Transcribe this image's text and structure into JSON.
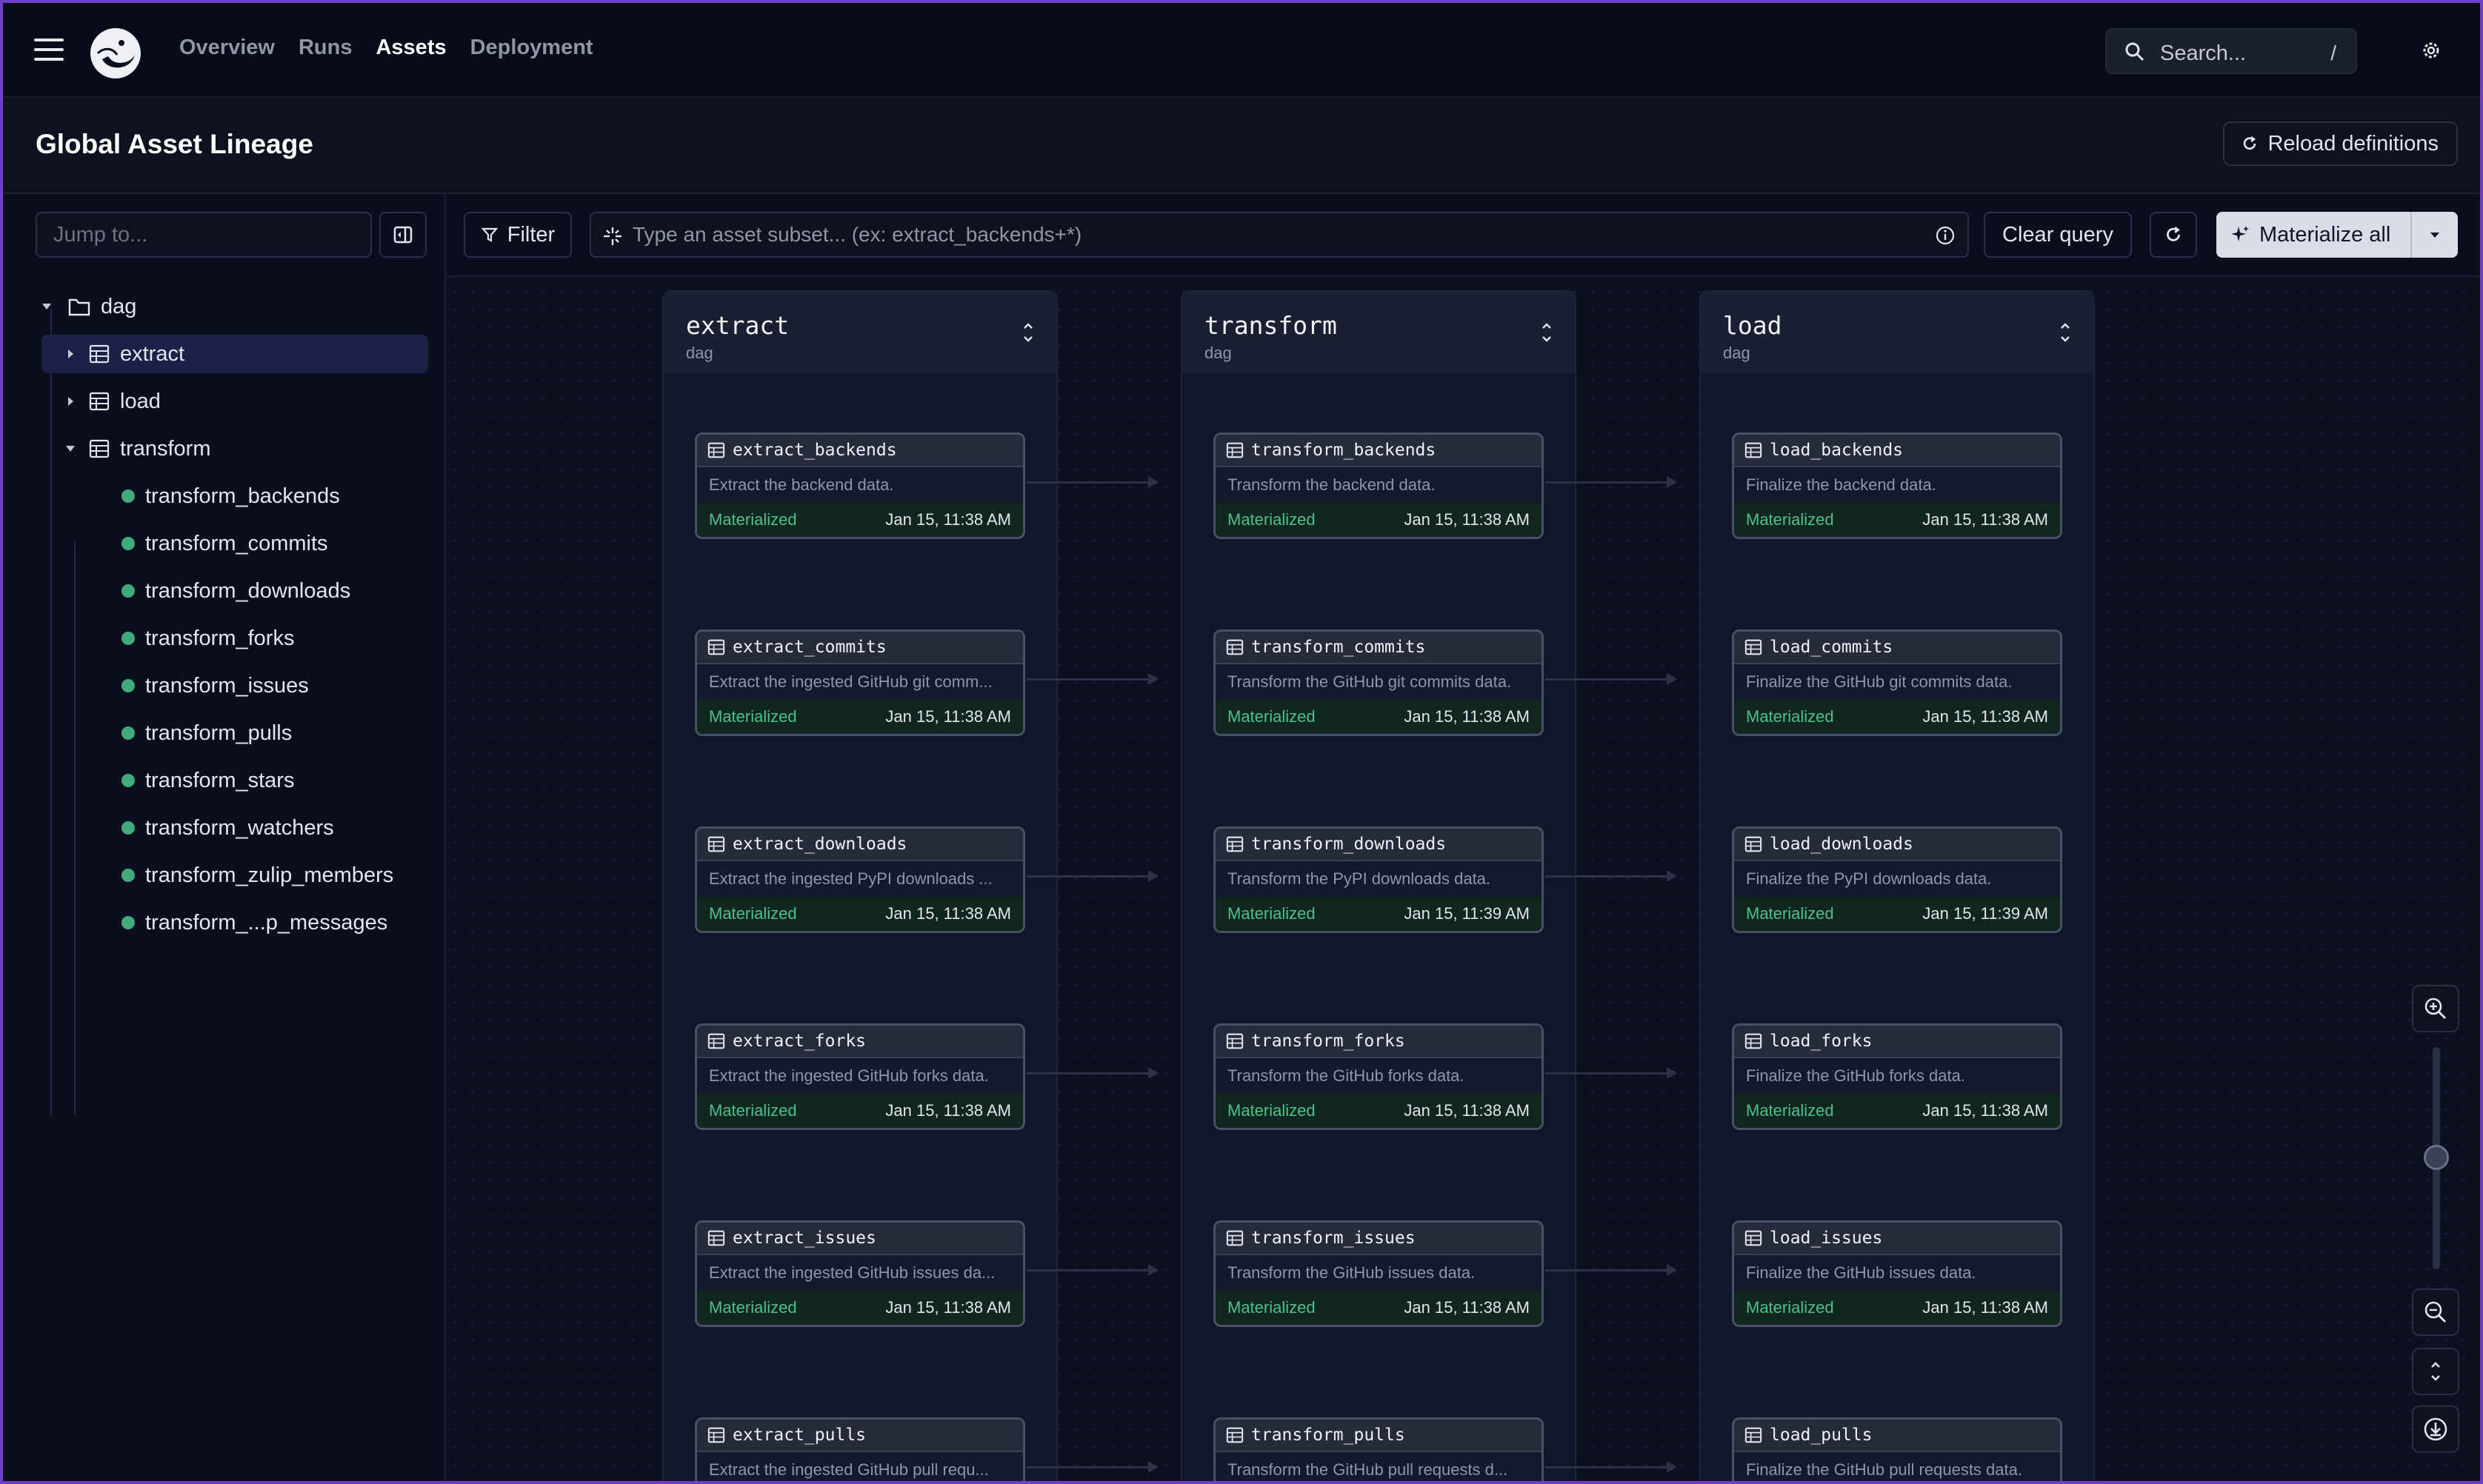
{
  "app": {
    "nav": [
      "Overview",
      "Runs",
      "Assets",
      "Deployment"
    ],
    "active_nav": "Assets",
    "search_placeholder": "Search...",
    "search_shortcut": "/"
  },
  "header": {
    "title": "Global Asset Lineage",
    "reload_label": "Reload definitions"
  },
  "sidebar": {
    "jump_placeholder": "Jump to...",
    "tree": {
      "root": "dag",
      "folders": [
        "extract",
        "load",
        "transform"
      ],
      "selected": "extract",
      "transform_children": [
        "transform_backends",
        "transform_commits",
        "transform_downloads",
        "transform_forks",
        "transform_issues",
        "transform_pulls",
        "transform_stars",
        "transform_watchers",
        "transform_zulip_members",
        "transform_...p_messages"
      ]
    }
  },
  "toolbar": {
    "filter_label": "Filter",
    "query_placeholder": "Type an asset subset... (ex: extract_backends+*)",
    "clear_label": "Clear query",
    "materialize_label": "Materialize all"
  },
  "groups": [
    {
      "title": "extract",
      "subtitle": "dag",
      "nodes": [
        {
          "name": "extract_backends",
          "desc": "Extract the backend data.",
          "status": "Materialized",
          "time": "Jan 15, 11:38 AM"
        },
        {
          "name": "extract_commits",
          "desc": "Extract the ingested GitHub git comm...",
          "status": "Materialized",
          "time": "Jan 15, 11:38 AM"
        },
        {
          "name": "extract_downloads",
          "desc": "Extract the ingested PyPI downloads ...",
          "status": "Materialized",
          "time": "Jan 15, 11:38 AM"
        },
        {
          "name": "extract_forks",
          "desc": "Extract the ingested GitHub forks data.",
          "status": "Materialized",
          "time": "Jan 15, 11:38 AM"
        },
        {
          "name": "extract_issues",
          "desc": "Extract the ingested GitHub issues da...",
          "status": "Materialized",
          "time": "Jan 15, 11:38 AM"
        },
        {
          "name": "extract_pulls",
          "desc": "Extract the ingested GitHub pull requ...",
          "status": "",
          "time": ""
        }
      ]
    },
    {
      "title": "transform",
      "subtitle": "dag",
      "nodes": [
        {
          "name": "transform_backends",
          "desc": "Transform the backend data.",
          "status": "Materialized",
          "time": "Jan 15, 11:38 AM"
        },
        {
          "name": "transform_commits",
          "desc": "Transform the GitHub git commits data.",
          "status": "Materialized",
          "time": "Jan 15, 11:38 AM"
        },
        {
          "name": "transform_downloads",
          "desc": "Transform the PyPI downloads data.",
          "status": "Materialized",
          "time": "Jan 15, 11:39 AM"
        },
        {
          "name": "transform_forks",
          "desc": "Transform the GitHub forks data.",
          "status": "Materialized",
          "time": "Jan 15, 11:38 AM"
        },
        {
          "name": "transform_issues",
          "desc": "Transform the GitHub issues data.",
          "status": "Materialized",
          "time": "Jan 15, 11:38 AM"
        },
        {
          "name": "transform_pulls",
          "desc": "Transform the GitHub pull requests d...",
          "status": "",
          "time": ""
        }
      ]
    },
    {
      "title": "load",
      "subtitle": "dag",
      "nodes": [
        {
          "name": "load_backends",
          "desc": "Finalize the backend data.",
          "status": "Materialized",
          "time": "Jan 15, 11:38 AM"
        },
        {
          "name": "load_commits",
          "desc": "Finalize the GitHub git commits data.",
          "status": "Materialized",
          "time": "Jan 15, 11:38 AM"
        },
        {
          "name": "load_downloads",
          "desc": "Finalize the PyPI downloads data.",
          "status": "Materialized",
          "time": "Jan 15, 11:39 AM"
        },
        {
          "name": "load_forks",
          "desc": "Finalize the GitHub forks data.",
          "status": "Materialized",
          "time": "Jan 15, 11:38 AM"
        },
        {
          "name": "load_issues",
          "desc": "Finalize the GitHub issues data.",
          "status": "Materialized",
          "time": "Jan 15, 11:38 AM"
        },
        {
          "name": "load_pulls",
          "desc": "Finalize the GitHub pull requests data.",
          "status": "",
          "time": ""
        }
      ]
    }
  ],
  "colors": {
    "accent_purple": "#6e3fc9",
    "materialized_green": "#4cc18d",
    "selected_bg": "#1e2147"
  },
  "icons": [
    "menu-icon",
    "dagster-logo",
    "search-icon",
    "gear-icon",
    "reload-icon",
    "sidebar-collapse-icon",
    "folder-icon",
    "table-icon",
    "filter-icon",
    "sparkle-icon",
    "info-icon",
    "refresh-icon",
    "zoom-in-icon",
    "zoom-out-icon",
    "download-icon"
  ]
}
